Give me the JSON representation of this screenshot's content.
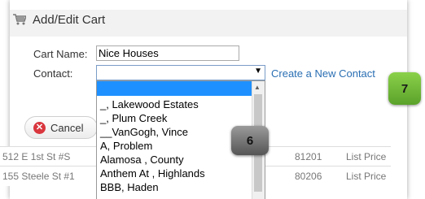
{
  "header": {
    "title": "Add/Edit Cart",
    "icon": "cart-icon"
  },
  "form": {
    "cart_name_label": "Cart Name:",
    "cart_name_value": "Nice Houses",
    "contact_label": "Contact:",
    "contact_value": "",
    "create_contact_link": "Create a New Contact",
    "cancel_label": "Cancel"
  },
  "badges": {
    "seven": "7",
    "six": "6"
  },
  "dropdown": {
    "items": [
      "_, Lakewood Estates",
      "_, Plum Creek",
      "__VanGogh, Vince",
      "A, Problem",
      "Alamosa , County",
      "Anthem At , Highlands",
      "BBB, Haden"
    ]
  },
  "table": {
    "rows": [
      {
        "address": "512 E 1st St #S",
        "zip": "81201",
        "price_type": "List Price"
      },
      {
        "address": "155 Steele St #1",
        "zip": "80206",
        "price_type": "List Price"
      }
    ]
  },
  "colors": {
    "link": "#2a6fb3",
    "selected": "#1e90ff",
    "badge_green": "#6cbb35",
    "cancel_red": "#d9363e"
  }
}
